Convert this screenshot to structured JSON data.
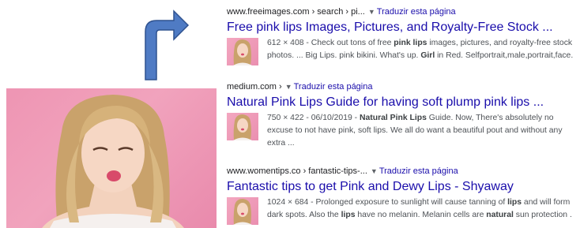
{
  "results": [
    {
      "cite_path": "www.freeimages.com › search › pi...",
      "translate": "Traduzir esta página",
      "title": "Free pink lips Images, Pictures, and Royalty-Free Stock ...",
      "snippet_html": "612 × 408 - Check out tons of free <b>pink lips</b> images, pictures, and royalty-free stock photos. ... Big Lips. pink bikini. What's up. <b>Girl</b> in Red. Selfportrait,male,portrait,face."
    },
    {
      "cite_path": "medium.com ›",
      "translate": "Traduzir esta página",
      "title": "Natural Pink Lips Guide for having soft plump pink lips ...",
      "snippet_html": "750 × 422 - 06/10/2019 - <b>Natural Pink Lips</b> Guide. Now, There's absolutely no excuse to not have pink, soft lips. We all do want a beautiful pout and without any extra ..."
    },
    {
      "cite_path": "www.womentips.co › fantastic-tips-...",
      "translate": "Traduzir esta página",
      "title": "Fantastic tips to get Pink and Dewy Lips - Shyaway",
      "snippet_html": "1024 × 684 - Prolonged exposure to sunlight will cause tanning of <b>lips</b> and will form dark spots. Also the <b>lips</b> have no melanin. Melanin cells are <b>natural</b> sun protection ."
    }
  ],
  "colors": {
    "link": "#1a0dab",
    "arrow_fill": "#4f7bc4",
    "arrow_stroke": "#2f528f",
    "pink_bg": "#ee95b3"
  }
}
